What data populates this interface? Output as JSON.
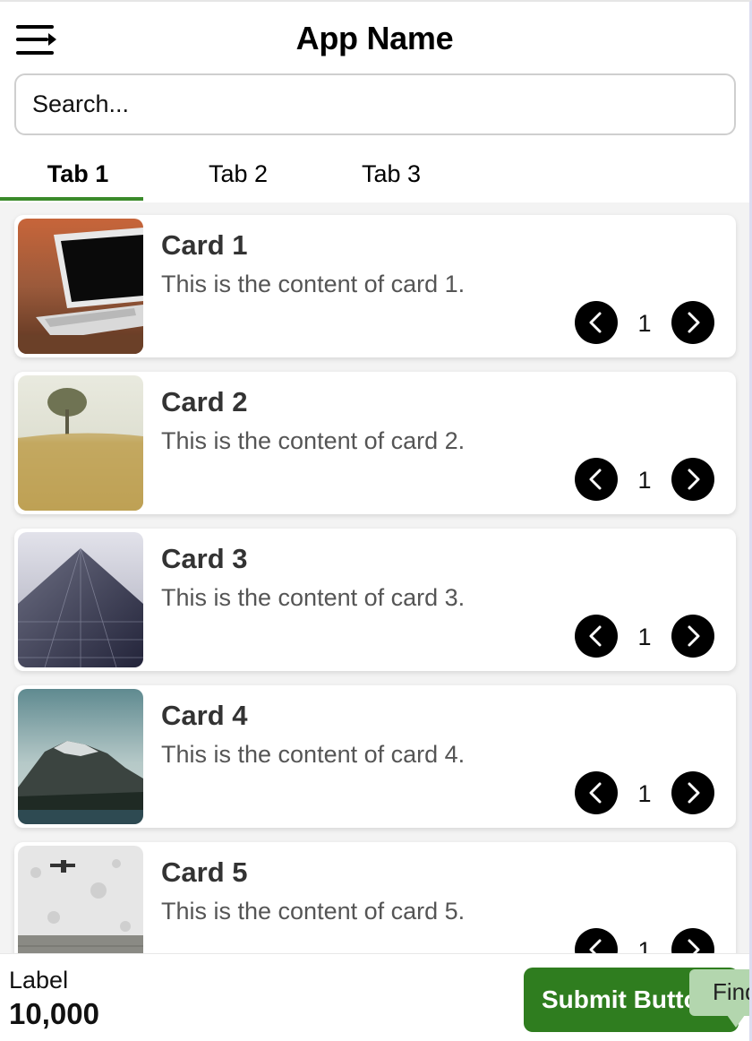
{
  "app": {
    "title": "App Name"
  },
  "header": {
    "menu_icon": "menu-icon"
  },
  "search": {
    "placeholder": "Search..."
  },
  "tabs": [
    {
      "label": "Tab 1",
      "active": true
    },
    {
      "label": "Tab 2",
      "active": false
    },
    {
      "label": "Tab 3",
      "active": false
    }
  ],
  "colors": {
    "accent": "#3a8a2a",
    "submit": "#2f7d1f",
    "tooltip": "#b3d6ae"
  },
  "cards": [
    {
      "title": "Card 1",
      "content": "This is the content of card 1.",
      "count": "1",
      "image": "laptop-photo"
    },
    {
      "title": "Card 2",
      "content": "This is the content of card 2.",
      "count": "1",
      "image": "field-tree-photo"
    },
    {
      "title": "Card 3",
      "content": "This is the content of card 3.",
      "count": "1",
      "image": "skyscraper-photo"
    },
    {
      "title": "Card 4",
      "content": "This is the content of card 4.",
      "count": "1",
      "image": "mountain-photo"
    },
    {
      "title": "Card 5",
      "content": "This is the content of card 5.",
      "count": "1",
      "image": "wall-photo"
    }
  ],
  "footer": {
    "label": "Label",
    "value": "10,000",
    "submit_label": "Submit Button",
    "tooltip_text": "Find"
  }
}
